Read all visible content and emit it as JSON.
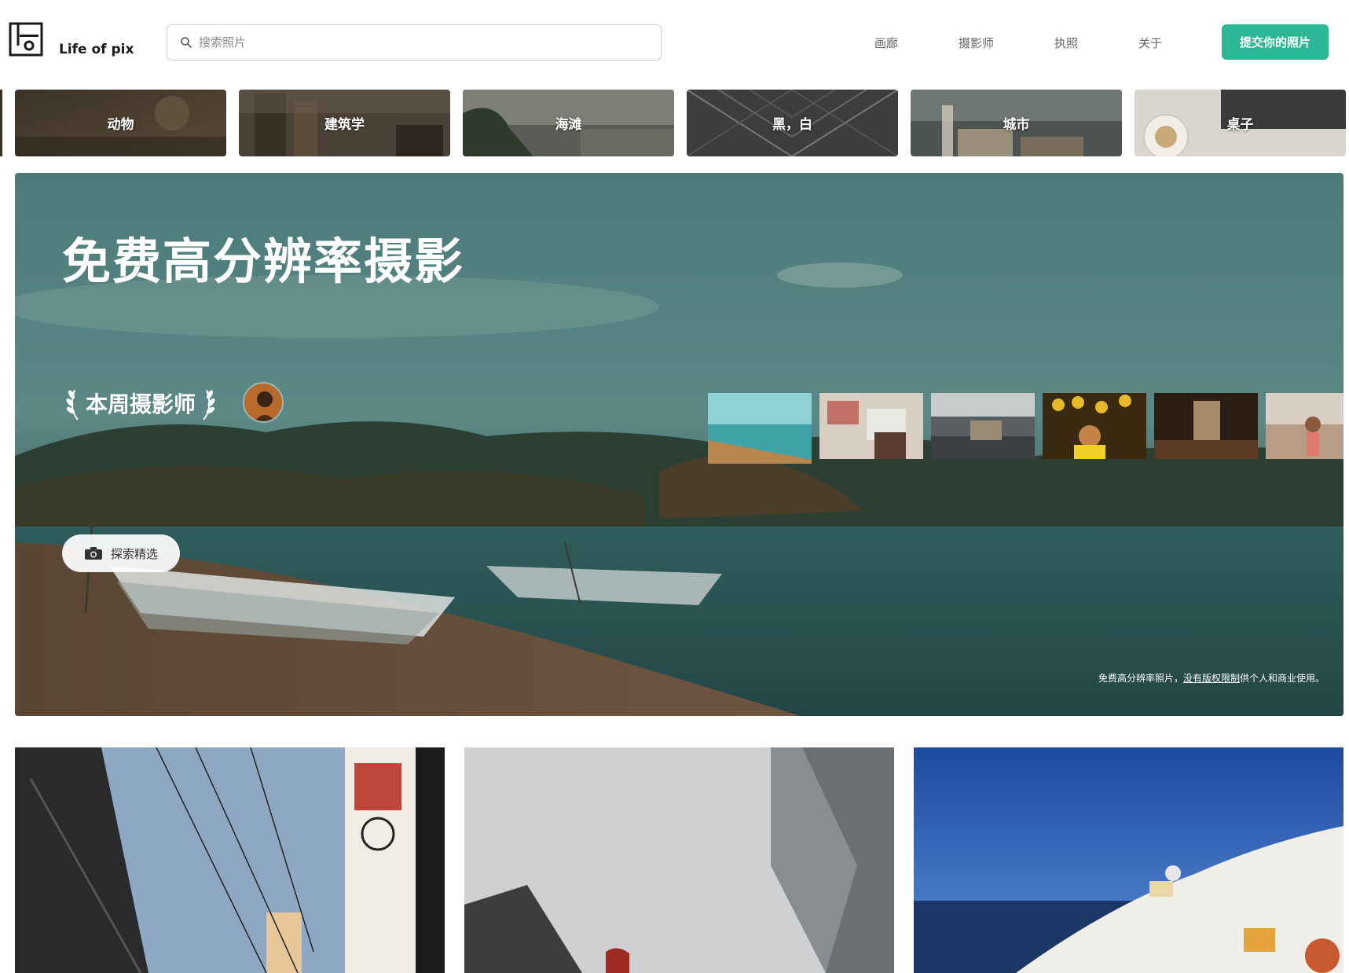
{
  "brand": {
    "name": "Life of pix"
  },
  "search": {
    "placeholder": "搜索照片"
  },
  "nav": {
    "items": [
      {
        "label": "画廊"
      },
      {
        "label": "摄影师"
      },
      {
        "label": "执照"
      },
      {
        "label": "关于"
      }
    ],
    "submit_label": "提交你的照片"
  },
  "categories": [
    {
      "label": "动物"
    },
    {
      "label": "建筑学"
    },
    {
      "label": "海滩"
    },
    {
      "label": "黑，白"
    },
    {
      "label": "城市"
    },
    {
      "label": "桌子"
    }
  ],
  "hero": {
    "title": "免费高分辨率摄影",
    "weekly_label": "本周摄影师",
    "explore_label": "探索精选",
    "caption_prefix": "免费高分辨率照片，",
    "caption_link": "没有版权限制",
    "caption_suffix": "供个人和商业使用。"
  },
  "colors": {
    "accent": "#2cb796",
    "hero_sky": "#4e7c7a",
    "hero_water": "#2f5d5c"
  },
  "icons": {
    "search": "search-icon",
    "camera": "camera-icon",
    "laurel": "laurel-icon"
  }
}
